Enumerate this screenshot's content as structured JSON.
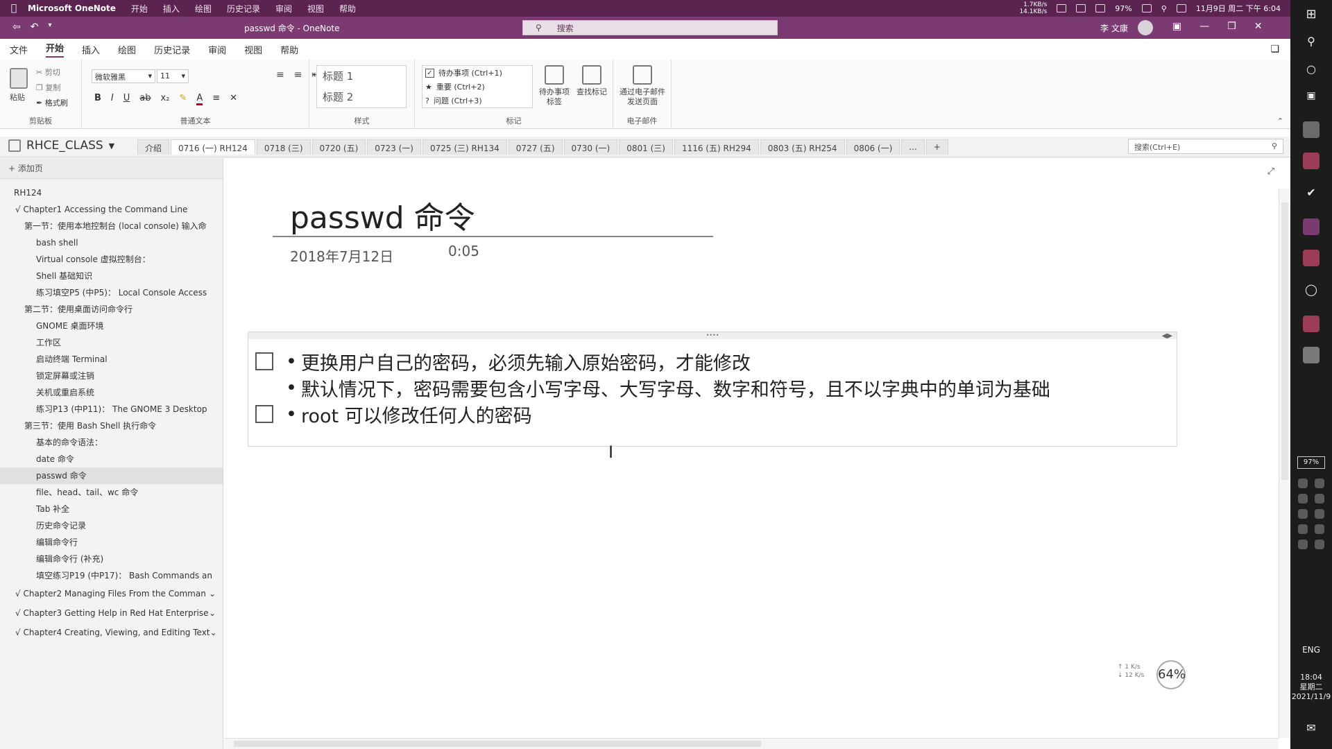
{
  "menubar": {
    "app_name": "Microsoft OneNote",
    "items": [
      "开始",
      "插入",
      "绘图",
      "历史记录",
      "审阅",
      "视图",
      "帮助"
    ],
    "net_up": "1.7KB/s",
    "net_down": "14.1KB/s",
    "battery": "97%",
    "datetime": "11月9日 周二 下午 6:04"
  },
  "titlebar": {
    "window_title": "passwd 命令 - OneNote",
    "search_placeholder": "搜索",
    "user_name": "李 文康",
    "tooltip_primary": "开始"
  },
  "ribbon_tabs": [
    "文件",
    "开始",
    "插入",
    "绘图",
    "历史记录",
    "审阅",
    "视图",
    "帮助"
  ],
  "ribbon": {
    "clipboard": {
      "paste": "粘贴",
      "cut": "剪切",
      "copy": "复制",
      "format_painter": "格式刷",
      "label": "剪贴板"
    },
    "text": {
      "font": "微软雅黑",
      "size": "11",
      "label": "普通文本"
    },
    "styles": {
      "h1": "标题 1",
      "h2": "标题 2",
      "label": "样式"
    },
    "tags": {
      "items": [
        {
          "label": "待办事项 (Ctrl+1)",
          "icon": "checkbox-icon"
        },
        {
          "label": "重要 (Ctrl+2)",
          "icon": "star-icon"
        },
        {
          "label": "问题 (Ctrl+3)",
          "icon": "question-icon"
        }
      ],
      "todo_tag": "待办事项标签",
      "find_tags": "查找标记",
      "label": "标记"
    },
    "email": {
      "send": "通过电子邮件发送页面",
      "label": "电子邮件"
    }
  },
  "notebook": {
    "name": "RHCE_CLASS",
    "sections": [
      "介绍",
      "0716 (一) RH124",
      "0718 (三)",
      "0720 (五)",
      "0723 (一)",
      "0725 (三) RH134",
      "0727 (五)",
      "0730 (一)",
      "0801 (三)",
      "1116 (五) RH294",
      "0803 (五) RH254",
      "0806 (一)",
      "..."
    ],
    "active_section": 1,
    "search_placeholder": "搜索(Ctrl+E)"
  },
  "pagelist": {
    "add_page": "添加页",
    "pages": [
      {
        "title": "RH124",
        "level": 0
      },
      {
        "title": "√ Chapter1 Accessing the Command Line",
        "level": 1
      },
      {
        "title": "第一节：使用本地控制台 (local console) 输入命",
        "level": 2
      },
      {
        "title": "bash shell",
        "level": 3
      },
      {
        "title": "Virtual console 虚拟控制台：",
        "level": 3
      },
      {
        "title": "Shell 基础知识",
        "level": 3
      },
      {
        "title": "练习填空P5 (中P5)： Local Console Access",
        "level": 3
      },
      {
        "title": "第二节：使用桌面访问命令行",
        "level": 2
      },
      {
        "title": "GNOME 桌面环境",
        "level": 3
      },
      {
        "title": "工作区",
        "level": 3
      },
      {
        "title": "启动终端 Terminal",
        "level": 3
      },
      {
        "title": "锁定屏幕或注销",
        "level": 3
      },
      {
        "title": "关机或重启系统",
        "level": 3
      },
      {
        "title": "练习P13 (中P11)： The GNOME 3 Desktop",
        "level": 3
      },
      {
        "title": "第三节：使用 Bash Shell 执行命令",
        "level": 2
      },
      {
        "title": "基本的命令语法：",
        "level": 3
      },
      {
        "title": "date 命令",
        "level": 3
      },
      {
        "title": "passwd 命令",
        "level": 3
      },
      {
        "title": "file、head、tail、wc 命令",
        "level": 3
      },
      {
        "title": "Tab 补全",
        "level": 3
      },
      {
        "title": "历史命令记录",
        "level": 3
      },
      {
        "title": "编辑命令行",
        "level": 3
      },
      {
        "title": "编辑命令行 (补充)",
        "level": 3
      },
      {
        "title": "填空练习P19 (中P17)： Bash Commands an",
        "level": 3
      }
    ],
    "selected_index": 17,
    "chapters": [
      "√ Chapter2 Managing Files From the Comman",
      "√ Chapter3 Getting Help in Red Hat Enterprise",
      "√ Chapter4 Creating, Viewing, and Editing Text"
    ]
  },
  "page": {
    "title": "passwd 命令",
    "date": "2018年7月12日",
    "time": "0:05",
    "lines": [
      {
        "text": "更换用户自己的密码，必须先输入原始密码，才能修改",
        "todo": true
      },
      {
        "text": "默认情况下，密码需要包含小写字母、大写字母、数字和符号，且不以字典中的单词为基础",
        "todo": false
      },
      {
        "text": "root 可以修改任何人的密码",
        "todo": true
      }
    ]
  },
  "status": {
    "zoom": "64%",
    "net_up": "1 K/s",
    "net_down": "12 K/s"
  },
  "taskbar": {
    "battery": "97%",
    "lang": "ENG",
    "time": "18:04",
    "weekday": "星期二",
    "date": "2021/11/9"
  },
  "colors": {
    "accent": "#7b3a71",
    "menubar": "#5a2350"
  }
}
